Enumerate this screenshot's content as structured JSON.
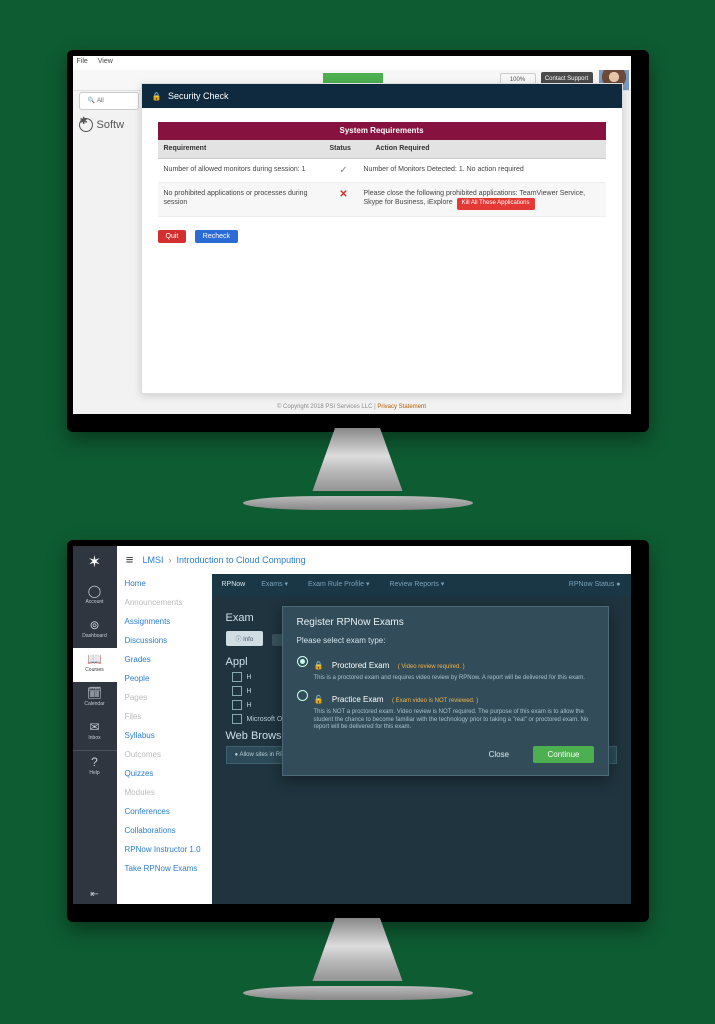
{
  "screen1": {
    "menu": {
      "file": "File",
      "view": "View"
    },
    "toolbar": {
      "pill": "100%",
      "support": "Contact Support"
    },
    "tab_label": "All",
    "brand": "Softw",
    "panel": {
      "title": "Security Check",
      "lock": "🔒"
    },
    "ribbon": "System Requirements",
    "cols": {
      "req": "Requirement",
      "status": "Status",
      "action": "Action Required"
    },
    "rows": [
      {
        "req": "Number of allowed monitors during session: 1",
        "ok": true,
        "mark": "✓",
        "action": "Number of Monitors Detected: 1. No action required"
      },
      {
        "req": "No prohibited applications or processes during session",
        "ok": false,
        "mark": "✕",
        "action": "Please close the following prohibited applications: TeamViewer Service, Skype for Business, iExplore",
        "kill": "Kill All These Applications"
      }
    ],
    "btns": {
      "quit": "Quit",
      "recheck": "Recheck"
    },
    "footer": {
      "copy": "© Copyright 2018 PSI Services LLC | ",
      "link": "Privacy Statement"
    }
  },
  "screen2": {
    "breadcrumb": {
      "root": "LMSI",
      "course": "Introduction to Cloud Computing"
    },
    "nav": [
      {
        "glyph": "✶",
        "label": ""
      },
      {
        "glyph": "◯",
        "label": "Account"
      },
      {
        "glyph": "⊚",
        "label": "Dashboard"
      },
      {
        "glyph": "📖",
        "label": "Courses",
        "active": true
      },
      {
        "glyph": "🗓",
        "label": "Calendar"
      },
      {
        "glyph": "✉",
        "label": "Inbox"
      },
      {
        "glyph": "?",
        "label": "Help"
      }
    ],
    "collapse": "⇤",
    "side": [
      {
        "t": "Home"
      },
      {
        "t": "Announcements",
        "dim": true
      },
      {
        "t": "Assignments"
      },
      {
        "t": "Discussions"
      },
      {
        "t": "Grades"
      },
      {
        "t": "People"
      },
      {
        "t": "Pages",
        "dim": true
      },
      {
        "t": "Files",
        "dim": true
      },
      {
        "t": "Syllabus"
      },
      {
        "t": "Outcomes",
        "dim": true
      },
      {
        "t": "Quizzes"
      },
      {
        "t": "Modules",
        "dim": true
      },
      {
        "t": "Conferences"
      },
      {
        "t": "Collaborations"
      },
      {
        "t": "RPNow Instructor 1.0"
      },
      {
        "t": "Take RPNow Exams"
      }
    ],
    "mhead": {
      "brand": "RPNow",
      "i1": "Exams ▾",
      "i2": "Exam Rule Profile ▾",
      "i3": "Review Reports ▾",
      "right": "RPNow Status ●"
    },
    "sections": {
      "exam": "Exam",
      "appl": "Appl",
      "apps": [
        "H",
        "H",
        "H",
        "Microsoft Outlook"
      ],
      "web": "Web Browsing",
      "webnote": "● Allow sites in RPNow browser \"In\" and \"Search\" websites"
    },
    "modal": {
      "title": "Register RPNow Exams",
      "prompt": "Please select exam type:",
      "opts": [
        {
          "on": true,
          "ico": "🔒",
          "label": "Proctored Exam",
          "hint": "( Video review required. )",
          "desc": "This is a proctored exam and requires video review by RPNow. A report will be delivered for this exam."
        },
        {
          "on": false,
          "ico": "🔓",
          "label": "Practice Exam",
          "hint": "( Exam video is NOT reviewed. )",
          "desc": "This is NOT a proctored exam. Video review is NOT required. The purpose of this exam is to allow the student the chance to become familiar with the technology prior to taking a \"real\" or proctored exam. No report will be delivered for this exam."
        }
      ],
      "close": "Close",
      "go": "Continue"
    }
  }
}
